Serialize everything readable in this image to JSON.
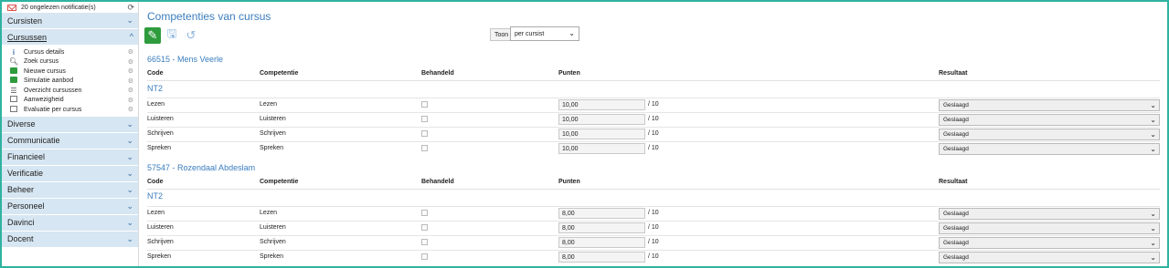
{
  "sidebar": {
    "notification": "20 ongelezen notificatie(s)",
    "sections_top": [
      {
        "label": "Cursisten"
      }
    ],
    "open_section": {
      "label": "Cursussen"
    },
    "subitems": [
      {
        "label": "Cursus details",
        "icon": "info-icon"
      },
      {
        "label": "Zoek cursus",
        "icon": "search-icon"
      },
      {
        "label": "Nieuwe cursus",
        "icon": "add-icon"
      },
      {
        "label": "Simulatie aanbod",
        "icon": "add-icon"
      },
      {
        "label": "Overzicht cursussen",
        "icon": "list-icon"
      },
      {
        "label": "Aanwezigheid",
        "icon": "grid-icon"
      },
      {
        "label": "Evaluatie per cursus",
        "icon": "grid-icon"
      }
    ],
    "sections_bottom": [
      {
        "label": "Diverse"
      },
      {
        "label": "Communicatie"
      },
      {
        "label": "Financieel"
      },
      {
        "label": "Verificatie"
      },
      {
        "label": "Beheer"
      },
      {
        "label": "Personeel"
      },
      {
        "label": "Davinci"
      },
      {
        "label": "Docent"
      }
    ]
  },
  "main": {
    "title": "Competenties van cursus",
    "toon_label": "Toon",
    "toon_value": "per cursist",
    "headers": {
      "code": "Code",
      "competentie": "Competentie",
      "behandeld": "Behandeld",
      "punten": "Punten",
      "resultaat": "Resultaat"
    },
    "groups": [
      {
        "student": "66515 - Mens Veerle",
        "course_code": "NT2",
        "rows": [
          {
            "code": "Lezen",
            "competentie": "Lezen",
            "punten": "10,00",
            "max": "/ 10",
            "resultaat": "Geslaagd"
          },
          {
            "code": "Luisteren",
            "competentie": "Luisteren",
            "punten": "10,00",
            "max": "/ 10",
            "resultaat": "Geslaagd"
          },
          {
            "code": "Schrijven",
            "competentie": "Schrijven",
            "punten": "10,00",
            "max": "/ 10",
            "resultaat": "Geslaagd"
          },
          {
            "code": "Spreken",
            "competentie": "Spreken",
            "punten": "10,00",
            "max": "/ 10",
            "resultaat": "Geslaagd"
          }
        ]
      },
      {
        "student": "57547 - Rozendaal Abdeslam",
        "course_code": "NT2",
        "rows": [
          {
            "code": "Lezen",
            "competentie": "Lezen",
            "punten": "8,00",
            "max": "/ 10",
            "resultaat": "Geslaagd"
          },
          {
            "code": "Luisteren",
            "competentie": "Luisteren",
            "punten": "8,00",
            "max": "/ 10",
            "resultaat": "Geslaagd"
          },
          {
            "code": "Schrijven",
            "competentie": "Schrijven",
            "punten": "8,00",
            "max": "/ 10",
            "resultaat": "Geslaagd"
          },
          {
            "code": "Spreken",
            "competentie": "Spreken",
            "punten": "8,00",
            "max": "/ 10",
            "resultaat": "Geslaagd"
          }
        ]
      }
    ]
  }
}
